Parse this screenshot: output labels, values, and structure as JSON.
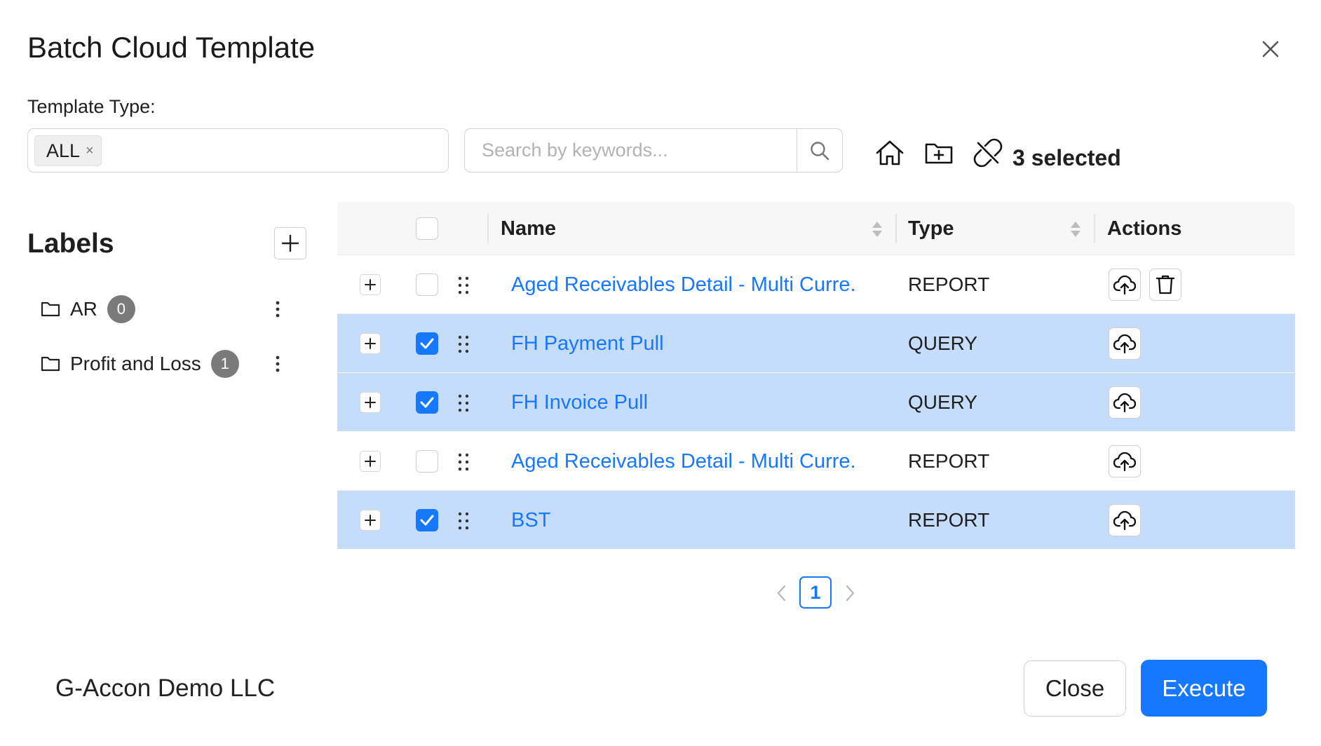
{
  "dialog": {
    "title": "Batch Cloud Template"
  },
  "filter": {
    "label": "Template Type:",
    "selected_tag": "ALL",
    "tag_remove": "×"
  },
  "search": {
    "placeholder": "Search by keywords..."
  },
  "toolbar": {
    "icons": [
      "home-icon",
      "folder-add-icon",
      "unlink-icon"
    ],
    "selected_text": "3 selected"
  },
  "labels": {
    "title": "Labels",
    "items": [
      {
        "name": "AR",
        "count": "0"
      },
      {
        "name": "Profit and Loss",
        "count": "1"
      }
    ]
  },
  "table": {
    "columns": {
      "name": "Name",
      "type": "Type",
      "actions": "Actions"
    },
    "rows": [
      {
        "name": "Aged Receivables Detail - Multi Curre.",
        "type": "REPORT",
        "selected": false,
        "actions": [
          "upload-cloud-icon",
          "delete-icon"
        ]
      },
      {
        "name": "FH Payment Pull",
        "type": "QUERY",
        "selected": true,
        "actions": [
          "upload-cloud-icon"
        ]
      },
      {
        "name": "FH Invoice Pull",
        "type": "QUERY",
        "selected": true,
        "actions": [
          "upload-cloud-icon"
        ]
      },
      {
        "name": "Aged Receivables Detail - Multi Curre.",
        "type": "REPORT",
        "selected": false,
        "actions": [
          "upload-cloud-icon"
        ]
      },
      {
        "name": "BST",
        "type": "REPORT",
        "selected": true,
        "actions": [
          "upload-cloud-icon"
        ]
      }
    ]
  },
  "pagination": {
    "current_page": "1"
  },
  "footer": {
    "company": "G-Accon Demo LLC",
    "close_label": "Close",
    "execute_label": "Execute"
  },
  "colors": {
    "primary": "#1677ff",
    "selected_row": "#c5dcfa",
    "badge": "#7a7a7a"
  }
}
